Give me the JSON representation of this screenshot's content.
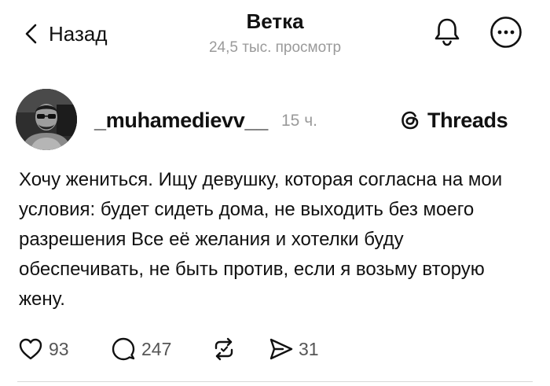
{
  "header": {
    "back_label": "Назад",
    "title": "Ветка",
    "views": "24,5 тыс. просмотр"
  },
  "post": {
    "username": "_muhamedievv__",
    "time": "15 ч.",
    "platform_label": "Threads",
    "text": "Хочу жениться. Ищу девушку, которая согласна на мои условия: будет сидеть дома, не выходить без моего разрешения Все её желания и хотелки буду обеспечивать, не быть против, если я возьму вторую жену."
  },
  "actions": {
    "likes": "93",
    "replies": "247",
    "shares": "31"
  },
  "icons": {
    "back": "chevron-left-icon",
    "notifications": "bell-icon",
    "menu": "more-horizontal-icon",
    "threads_logo": "threads-logo-icon",
    "like": "heart-icon",
    "reply": "comment-icon",
    "repost": "repost-icon",
    "share": "send-icon"
  }
}
